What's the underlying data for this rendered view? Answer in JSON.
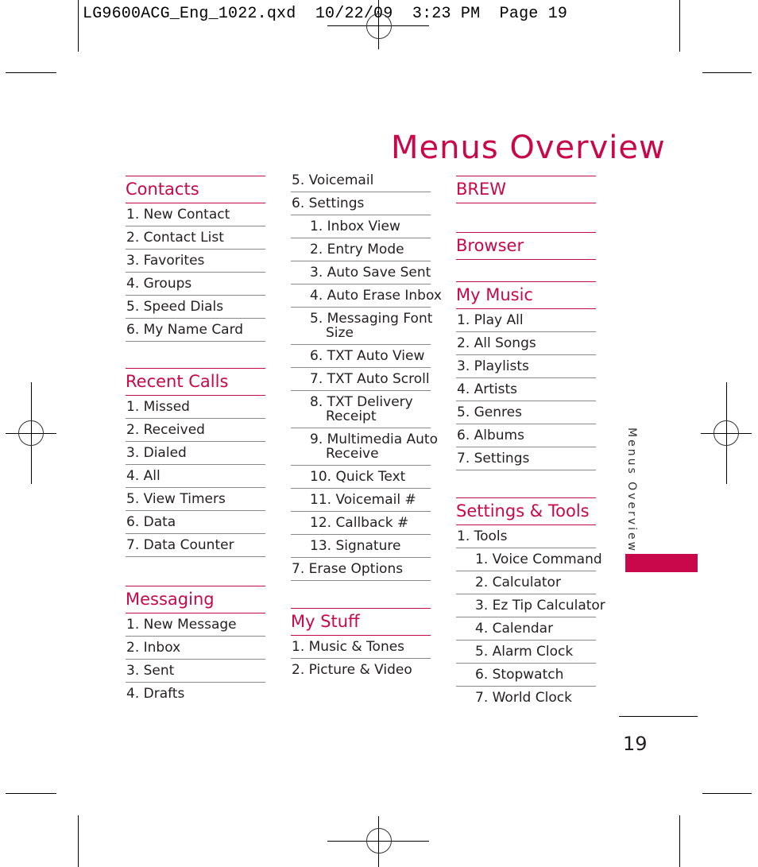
{
  "slug": "LG9600ACG_Eng_1022.qxd  10/22/09  3:23 PM  Page 19",
  "title": "Menus Overview",
  "accent_color": "#c8084a",
  "side_label": "Menus Overview",
  "page_number": "19",
  "columns": [
    {
      "sections": [
        {
          "heading": "Contacts",
          "items": [
            "1. New Contact",
            "2. Contact List",
            "3. Favorites",
            "4. Groups",
            "5. Speed Dials",
            "6. My Name Card"
          ]
        },
        {
          "heading": "Recent Calls",
          "items": [
            "1. Missed",
            "2. Received",
            "3. Dialed",
            "4. All",
            "5. View Timers",
            "6. Data",
            "7. Data Counter"
          ]
        },
        {
          "heading": "Messaging",
          "items": [
            "1. New Message",
            "2. Inbox",
            "3. Sent",
            "4. Drafts"
          ]
        }
      ]
    },
    {
      "continued_items": [
        {
          "label": "5. Voicemail"
        },
        {
          "label": "6. Settings"
        },
        {
          "label": "1. Inbox View",
          "sub": true
        },
        {
          "label": "2. Entry Mode",
          "sub": true
        },
        {
          "label": "3. Auto Save Sent",
          "sub": true
        },
        {
          "label": "4. Auto Erase Inbox",
          "sub": true
        },
        {
          "label": "5. Messaging Font",
          "cont": "Size",
          "sub": true
        },
        {
          "label": "6. TXT Auto View",
          "sub": true
        },
        {
          "label": "7.  TXT Auto Scroll",
          "sub": true
        },
        {
          "label": "8. TXT Delivery",
          "cont": "Receipt",
          "sub": true
        },
        {
          "label": "9. Multimedia Auto",
          "cont": "Receive",
          "sub": true
        },
        {
          "label": "10. Quick Text",
          "sub": true
        },
        {
          "label": "11. Voicemail #",
          "sub": true
        },
        {
          "label": "12. Callback #",
          "sub": true
        },
        {
          "label": "13. Signature",
          "sub": true
        },
        {
          "label": "7. Erase Options"
        }
      ],
      "sections": [
        {
          "heading": "My Stuff",
          "items": [
            "1. Music & Tones",
            "2. Picture & Video"
          ]
        }
      ]
    },
    {
      "sections": [
        {
          "heading": "BREW",
          "items": []
        },
        {
          "heading": "Browser",
          "items": []
        },
        {
          "heading": "My Music",
          "items": [
            "1. Play All",
            "2. All Songs",
            "3. Playlists",
            "4. Artists",
            "5. Genres",
            "6. Albums",
            "7. Settings"
          ]
        },
        {
          "heading": "Settings & Tools",
          "items": [
            "1. Tools",
            "1. Voice Command",
            "2. Calculator",
            "3. Ez Tip Calculator",
            "4. Calendar",
            "5. Alarm Clock",
            "6. Stopwatch",
            "7. World Clock"
          ]
        }
      ]
    }
  ]
}
